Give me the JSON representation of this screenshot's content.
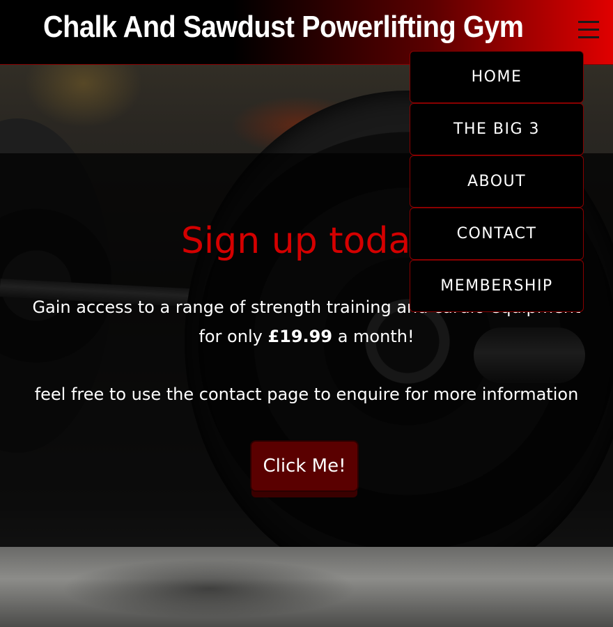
{
  "header": {
    "title": "Chalk And Sawdust Powerlifting Gym",
    "menu_icon": "hamburger-menu-icon"
  },
  "nav": {
    "items": [
      {
        "label": "HOME"
      },
      {
        "label": "THE BIG 3"
      },
      {
        "label": "ABOUT"
      },
      {
        "label": "CONTACT"
      },
      {
        "label": "MEMBERSHIP"
      }
    ]
  },
  "signup": {
    "heading": "Sign up today",
    "line1": "Gain access to a range of strength training and cardio equipment",
    "line2_prefix": "for only ",
    "price": "£19.99",
    "line2_suffix": " a month!",
    "contact_note": "feel free to use the contact page to enquire for more information",
    "button_label": "Click Me!"
  },
  "colors": {
    "accent": "#d40000",
    "header_gradient_end": "#e00000",
    "button_bg": "#5a0000"
  }
}
